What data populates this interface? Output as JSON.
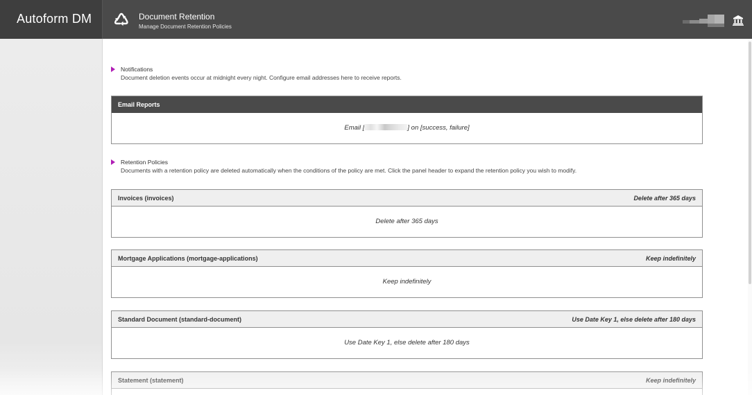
{
  "app": {
    "brand": "Autoform DM"
  },
  "header": {
    "title": "Document Retention",
    "subtitle": "Manage Document Retention Policies",
    "page_icon": "recycle-icon",
    "right_icon": "bank-icon",
    "colors": {
      "bar": "#4a4a4a",
      "brand": "#3e3e3e",
      "accent": "#b01eb5"
    }
  },
  "notifications": {
    "title": "Notifications",
    "description": "Document deletion events occur at midnight every night. Configure email addresses here to receive reports."
  },
  "email_reports": {
    "header": "Email Reports",
    "prefix": "Email [",
    "suffix": "] on [success, failure]"
  },
  "retention": {
    "title": "Retention Policies",
    "description": "Documents with a retention policy are deleted automatically when the conditions of the policy are met. Click the panel header to expand the retention policy you wish to modify."
  },
  "policies": [
    {
      "name": "Invoices (invoices)",
      "summary": "Delete after 365 days",
      "body": "Delete after 365 days"
    },
    {
      "name": "Mortgage Applications (mortgage-applications)",
      "summary": "Keep indefinitely",
      "body": "Keep indefinitely"
    },
    {
      "name": "Standard Document (standard-document)",
      "summary": "Use Date Key 1, else delete after 180 days",
      "body": "Use Date Key 1, else delete after 180 days"
    },
    {
      "name": "Statement (statement)",
      "summary": "Keep indefinitely",
      "body": ""
    }
  ]
}
